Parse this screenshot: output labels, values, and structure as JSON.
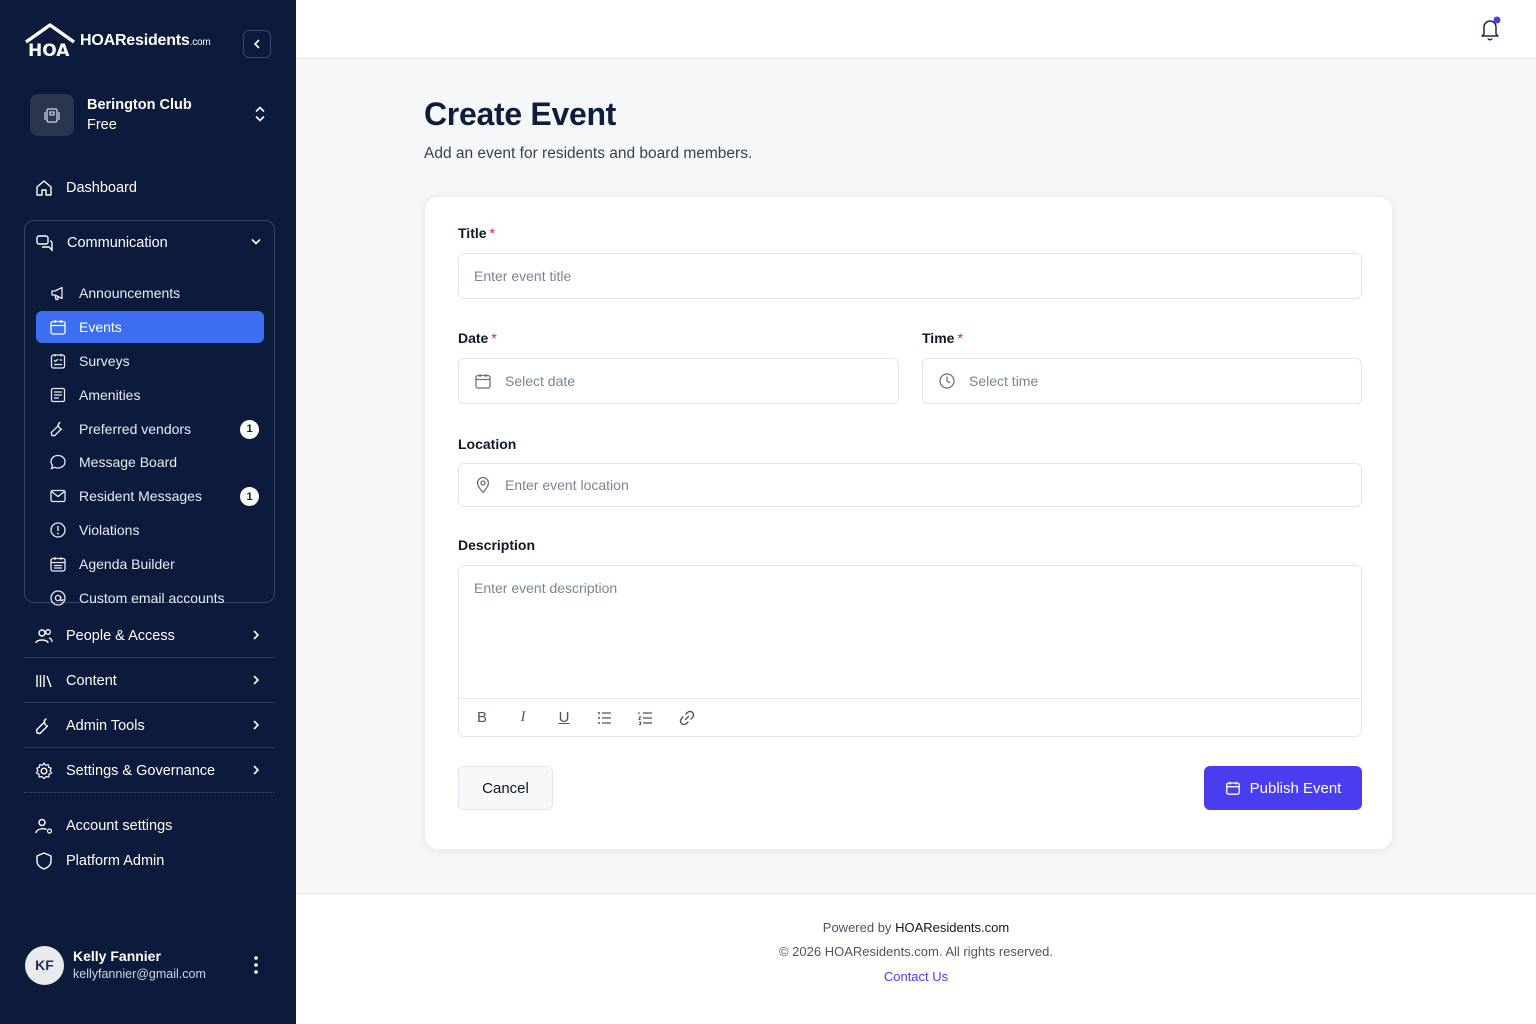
{
  "brand": {
    "name": "HOAResidents",
    "suffix": ".com",
    "logo_text": "HOA"
  },
  "org": {
    "name": "Berington Club",
    "plan": "Free"
  },
  "nav": {
    "dashboard": "Dashboard",
    "communication": {
      "label": "Communication",
      "items": [
        {
          "label": "Announcements",
          "icon": "megaphone-icon"
        },
        {
          "label": "Events",
          "icon": "calendar-icon",
          "active": true
        },
        {
          "label": "Surveys",
          "icon": "survey-icon"
        },
        {
          "label": "Amenities",
          "icon": "amenities-icon"
        },
        {
          "label": "Preferred vendors",
          "icon": "wrench-icon",
          "badge": "1"
        },
        {
          "label": "Message Board",
          "icon": "chat-bubble-icon"
        },
        {
          "label": "Resident Messages",
          "icon": "mail-icon",
          "badge": "1"
        },
        {
          "label": "Violations",
          "icon": "alert-circle-icon"
        },
        {
          "label": "Agenda Builder",
          "icon": "calendar-list-icon"
        },
        {
          "label": "Custom email accounts",
          "icon": "at-sign-icon"
        }
      ]
    },
    "groups": [
      {
        "label": "People & Access"
      },
      {
        "label": "Content"
      },
      {
        "label": "Admin Tools"
      },
      {
        "label": "Settings & Governance"
      }
    ],
    "account_settings": "Account settings",
    "platform_admin": "Platform Admin"
  },
  "user": {
    "initials": "KF",
    "name": "Kelly Fannier",
    "email": "kellyfannier@gmail.com"
  },
  "page": {
    "title": "Create Event",
    "subtitle": "Add an event for residents and board members."
  },
  "form": {
    "title_label": "Title",
    "title_placeholder": "Enter event title",
    "date_label": "Date",
    "date_placeholder": "Select date",
    "time_label": "Time",
    "time_placeholder": "Select time",
    "location_label": "Location",
    "location_placeholder": "Enter event location",
    "description_label": "Description",
    "description_placeholder": "Enter event description",
    "required_mark": "*",
    "cancel": "Cancel",
    "publish": "Publish Event"
  },
  "footer": {
    "powered_by": "Powered by",
    "powered_brand": "HOAResidents.com",
    "copyright": "© 2026 HOAResidents.com. All rights reserved.",
    "contact": "Contact Us"
  },
  "colors": {
    "sidebar_bg": "#0c1a3b",
    "active_nav": "#3b6ff0",
    "primary_button": "#4a3df0",
    "required": "#e11d48"
  }
}
